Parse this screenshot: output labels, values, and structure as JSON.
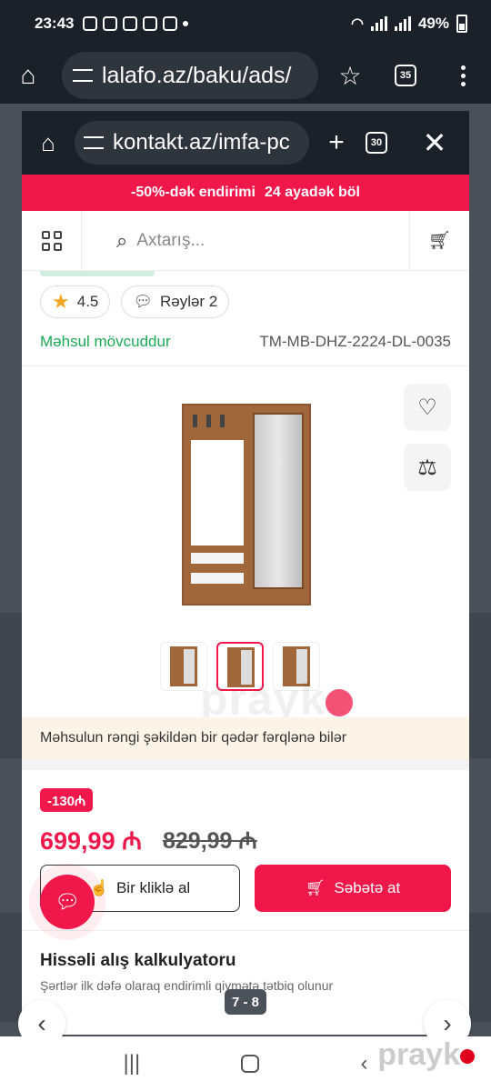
{
  "status_bar": {
    "time": "23:43",
    "battery": "49%"
  },
  "outer_browser": {
    "url": "lalafo.az/baku/ads/",
    "tabs_count": "35"
  },
  "inner_browser": {
    "url": "kontakt.az/imfa-pc",
    "tabs_count": "30"
  },
  "promo": {
    "part1": "-50%-dək endirimi",
    "part2": "24 ayadək böl"
  },
  "search": {
    "placeholder": "Axtarış..."
  },
  "product": {
    "rating": "4.5",
    "reviews": "Rəylər 2",
    "stock": "Məhsul mövcuddur",
    "sku": "TM-MB-DHZ-2224-DL-0035",
    "color_note": "Məhsulun rəngi şəkildən bir qədər fərqlənə bilər",
    "discount_badge": "-130₼",
    "price": "699,99 ₼",
    "old_price": "829,99 ₼"
  },
  "buttons": {
    "one_click": "Bir kliklə al",
    "add_to_cart": "Səbətə at"
  },
  "calculator": {
    "title": "Hissəli alış kalkulyatoru",
    "subtitle": "Şərtlər ilk dəfə olaraq endirimli qiymətə tətbiq olunur"
  },
  "pager": "7 - 8",
  "watermark": "prayk",
  "colors": {
    "accent": "#f0174a",
    "stock_green": "#1aaa55",
    "wood": "#a0673a"
  }
}
